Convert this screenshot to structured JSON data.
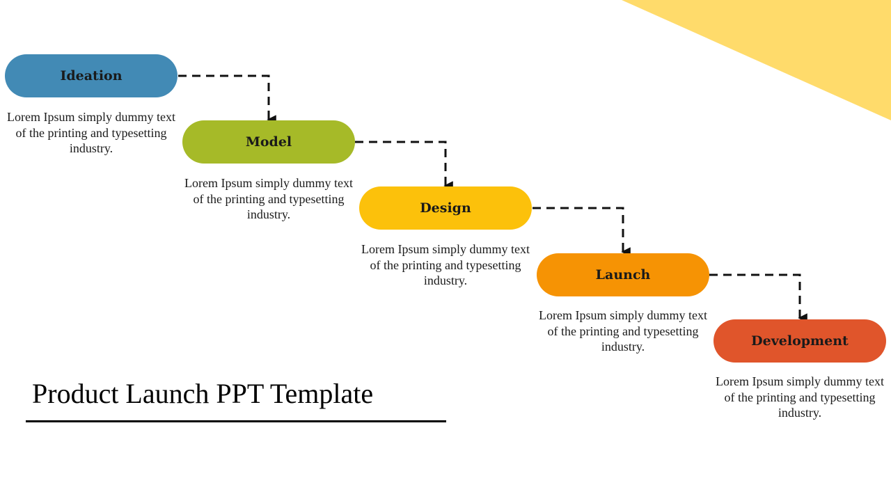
{
  "slide": {
    "title": "Product Launch PPT Template",
    "accent_triangle_color": "#FFDB6B"
  },
  "steps": [
    {
      "label": "Ideation",
      "color": "#428AB5",
      "description": "Lorem Ipsum simply dummy text of the printing and typesetting industry."
    },
    {
      "label": "Model",
      "color": "#A6BA28",
      "description": "Lorem Ipsum simply dummy text of the printing and typesetting industry."
    },
    {
      "label": "Design",
      "color": "#FCC10B",
      "description": "Lorem Ipsum simply dummy text of the printing and typesetting industry."
    },
    {
      "label": "Launch",
      "color": "#F69304",
      "description": "Lorem Ipsum simply dummy text of the printing and typesetting industry."
    },
    {
      "label": "Development",
      "color": "#E0552B",
      "description": "Lorem Ipsum simply dummy text of the printing and typesetting industry."
    }
  ],
  "connector": {
    "style": "dashed",
    "color": "#111111",
    "arrowhead": "arrow-down-icon"
  }
}
